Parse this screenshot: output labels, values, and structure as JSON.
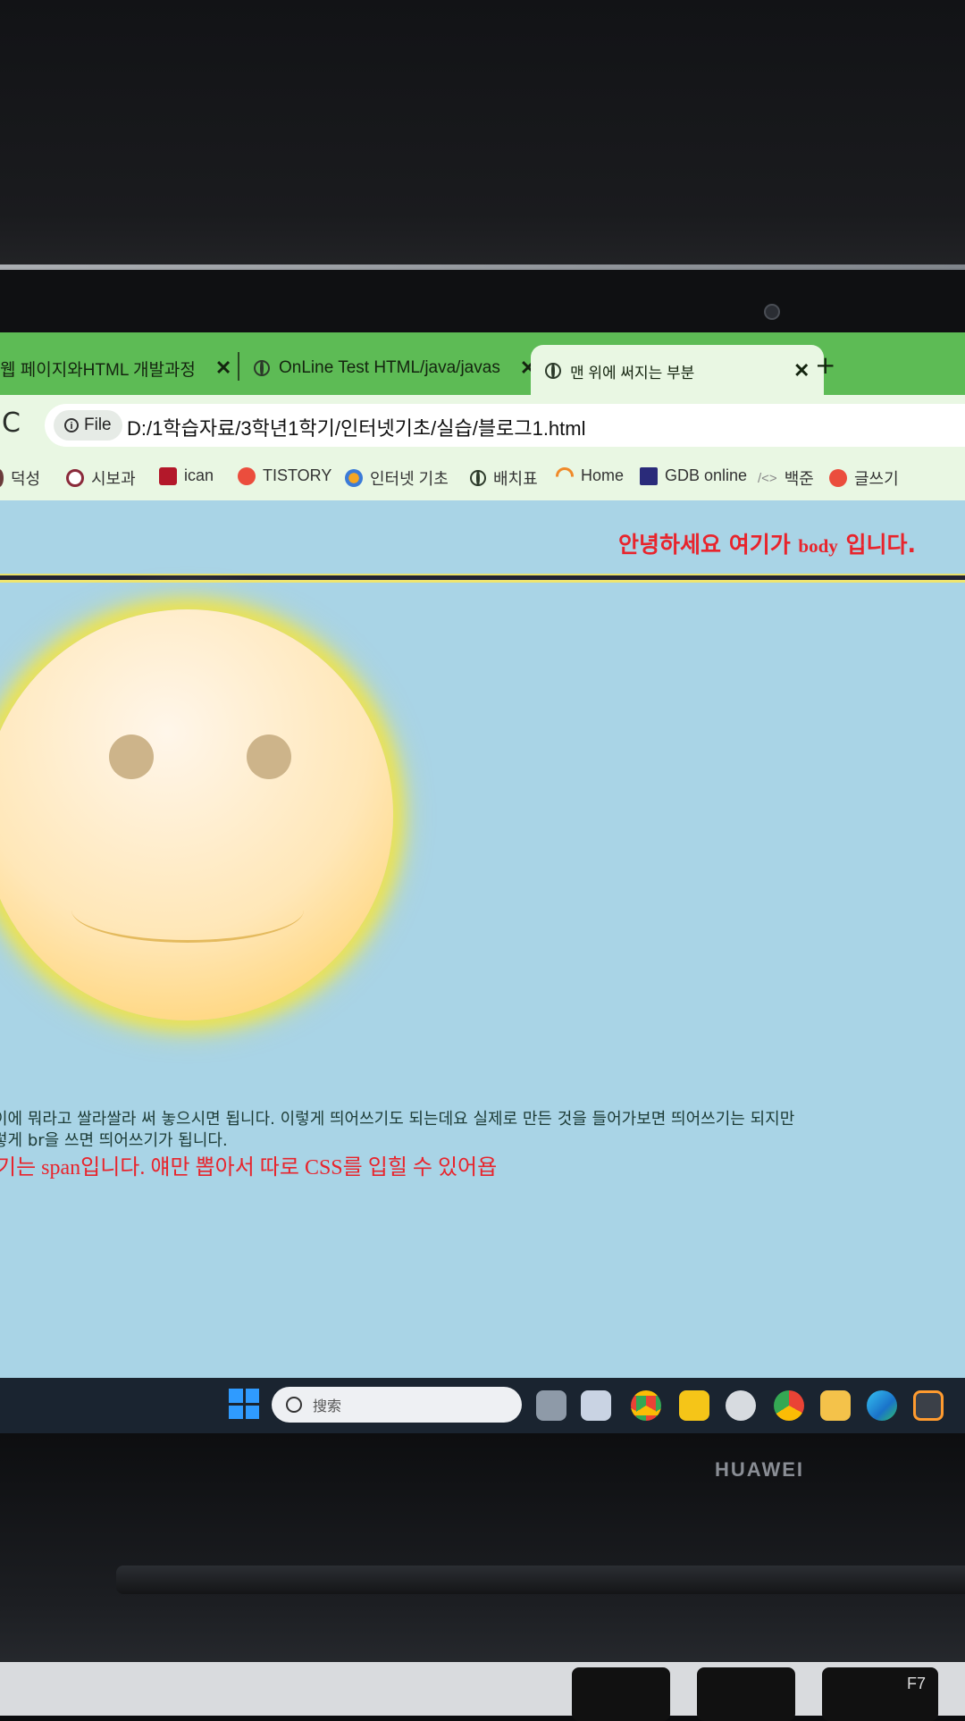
{
  "browser": {
    "tabs": [
      {
        "label": "웹 페이지와HTML 개발과정",
        "close": "✕"
      },
      {
        "label": "OnLine Test HTML/java/javas",
        "close": "✕"
      },
      {
        "label": "맨 위에 써지는 부분",
        "close": "✕"
      }
    ],
    "new_tab": "+",
    "reload": "C",
    "security_chip": "File",
    "url": "D:/1학습자료/3학년1학기/인터넷기초/실습/블로그1.html",
    "bookmarks": [
      "덕성",
      "시보과",
      "ican",
      "TISTORY",
      "인터넷 기초",
      "배치표",
      "Home",
      "GDB online",
      "백준",
      "글쓰기"
    ]
  },
  "page": {
    "header_pre": "안녕하세요 여기가 ",
    "header_body": "body",
    "header_post": " 입니다.",
    "line1": "이에 뭐라고 쌀라쌀라 써 놓으시면 됩니다. 이렇게 띄어쓰기도 되는데요 실제로 만든 것을 들어가보면 띄어쓰기는 되지만 ",
    "line2": "렇게 br을 쓰면 띄어쓰기가 됩니다.",
    "span_line": "기는 span입니다. 얘만 뽑아서 따로 CSS를 입힐 수 있어욥"
  },
  "taskbar": {
    "search_placeholder": "搜索"
  },
  "laptop": {
    "brand": "HUAWEI",
    "key_f7": "F7"
  },
  "colors": {
    "tab_strip": "#5dbb55",
    "page_bg": "#a9d4e6",
    "header_red": "#e8242c"
  }
}
